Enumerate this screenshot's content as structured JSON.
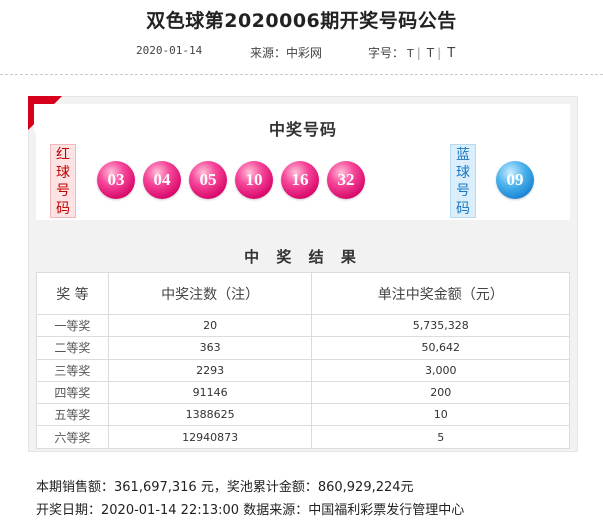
{
  "header": {
    "title": "双色球第2020006期开奖号码公告",
    "date": "2020-01-14",
    "source": "来源：中彩网",
    "font_label": "字号：",
    "font_sizes": [
      "T",
      "T",
      "T"
    ],
    "separator": "|"
  },
  "winning": {
    "heading": "中奖号码",
    "red_label": [
      "红",
      "球",
      "号",
      "码"
    ],
    "blue_label": [
      "蓝",
      "球",
      "号",
      "码"
    ],
    "red_balls": [
      "03",
      "04",
      "05",
      "10",
      "16",
      "32"
    ],
    "blue_ball": "09",
    "colors": {
      "red": "#d8086a",
      "blue": "#167fd0",
      "accent": "#d6001c"
    }
  },
  "results": {
    "heading": "中 奖 结 果",
    "columns": [
      "奖  等",
      "中奖注数（注）",
      "单注中奖金额（元）"
    ],
    "rows": [
      {
        "rank": "一等奖",
        "count": "20",
        "amount": "5,735,328"
      },
      {
        "rank": "二等奖",
        "count": "363",
        "amount": "50,642"
      },
      {
        "rank": "三等奖",
        "count": "2293",
        "amount": "3,000"
      },
      {
        "rank": "四等奖",
        "count": "91146",
        "amount": "200"
      },
      {
        "rank": "五等奖",
        "count": "1388625",
        "amount": "10"
      },
      {
        "rank": "六等奖",
        "count": "12940873",
        "amount": "5"
      }
    ]
  },
  "footer": {
    "sales_line": "本期销售额：361,697,316 元，奖池累计金额：860,929,224元",
    "draw_line": "开奖日期：2020-01-14 22:13:00 数据来源：中国福利彩票发行管理中心"
  }
}
